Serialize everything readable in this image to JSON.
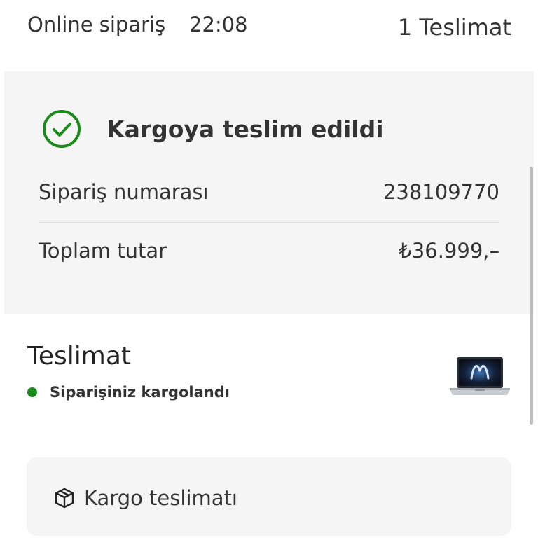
{
  "header": {
    "order_type": "Online sipariş",
    "order_time": "22:08",
    "delivery_count": "1 Teslimat"
  },
  "status_card": {
    "icon": "check-circle-icon",
    "title": "Kargoya teslim edildi",
    "order_number_label": "Sipariş numarası",
    "order_number_value": "238109770",
    "total_label": "Toplam tutar",
    "total_value": "₺36.999,–"
  },
  "delivery": {
    "title": "Teslimat",
    "status_text": "Siparişiniz kargolandı",
    "status_color": "#1a8a1a",
    "product_image": "laptop-thumbnail"
  },
  "shipping": {
    "icon": "package-box-icon",
    "label": "Kargo teslimatı"
  },
  "colors": {
    "accent_green": "#1a8a1a",
    "card_background": "#f5f5f5",
    "text_primary": "#333333"
  }
}
